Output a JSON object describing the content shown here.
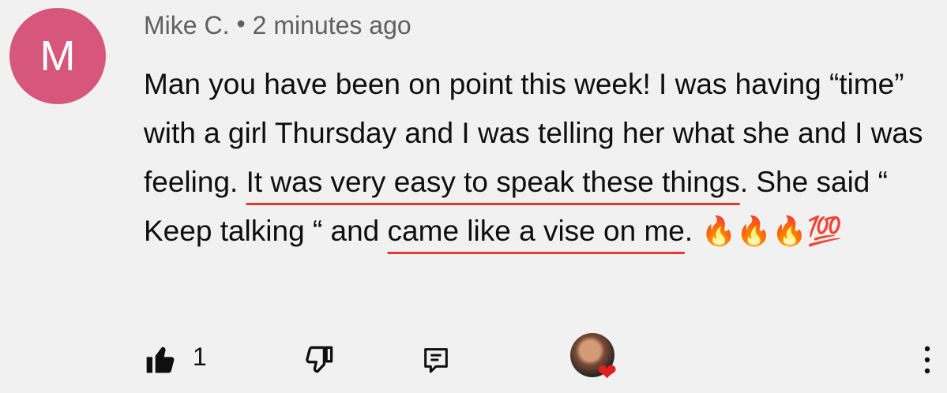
{
  "colors": {
    "avatar_bg": "#d6577b",
    "underline": "#e53a2a",
    "meta_text": "#606060",
    "heart": "#e02020"
  },
  "author": {
    "initial": "M",
    "name": "Mike C.",
    "separator": "•",
    "time": "2 minutes ago"
  },
  "comment": {
    "p1": "Man you have been on point this week! I was having “time” with a girl Thursday and I was telling her what she and I was feeling. ",
    "h1": "It was very easy to speak these things",
    "p2": ".  She said “ Keep talking “ and ",
    "h2": "came like a vise on me",
    "p3": ". ",
    "emojis": "🔥🔥🔥💯"
  },
  "actions": {
    "like_icon": "thumbs-up-icon",
    "like_count": "1",
    "dislike_icon": "thumbs-down-icon",
    "reply_icon": "reply-icon",
    "creator_heart_icon": "heart-icon",
    "more_icon": "more-vertical-icon"
  }
}
